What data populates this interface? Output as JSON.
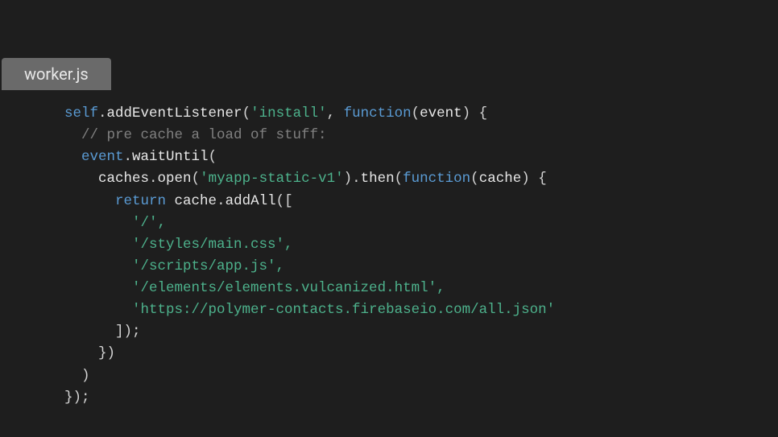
{
  "tab": {
    "filename": "worker.js"
  },
  "code": {
    "t_self": "self",
    "t_dot1": ".",
    "t_addEventListener": "addEventListener",
    "t_paren1": "(",
    "t_install": "'install'",
    "t_comma1": ", ",
    "t_function1": "function",
    "t_paren2": "(",
    "t_event1": "event",
    "t_paren3": ") {",
    "t_comment": "  // pre cache a load of stuff:",
    "t_indent2": "  ",
    "t_event2": "event",
    "t_dot2": ".",
    "t_waitUntil": "waitUntil",
    "t_paren4": "(",
    "t_indent4": "    ",
    "t_caches": "caches",
    "t_dot3": ".",
    "t_open": "open",
    "t_paren5": "(",
    "t_myapp": "'myapp-static-v1'",
    "t_paren6": ").",
    "t_then": "then",
    "t_paren7": "(",
    "t_function2": "function",
    "t_paren8": "(",
    "t_cache1": "cache",
    "t_paren9": ") {",
    "t_indent6": "      ",
    "t_return": "return",
    "t_space1": " ",
    "t_cache2": "cache",
    "t_dot4": ".",
    "t_addAll": "addAll",
    "t_paren10": "([",
    "t_line_root": "        '/',",
    "t_line_styles": "        '/styles/main.css',",
    "t_line_scripts": "        '/scripts/app.js',",
    "t_line_elements": "        '/elements/elements.vulcanized.html',",
    "t_line_url": "        'https://polymer-contacts.firebaseio.com/all.json'",
    "t_close_arr": "      ]);",
    "t_close_inner": "    })",
    "t_close_wait": "  )",
    "t_close_outer": "});"
  }
}
